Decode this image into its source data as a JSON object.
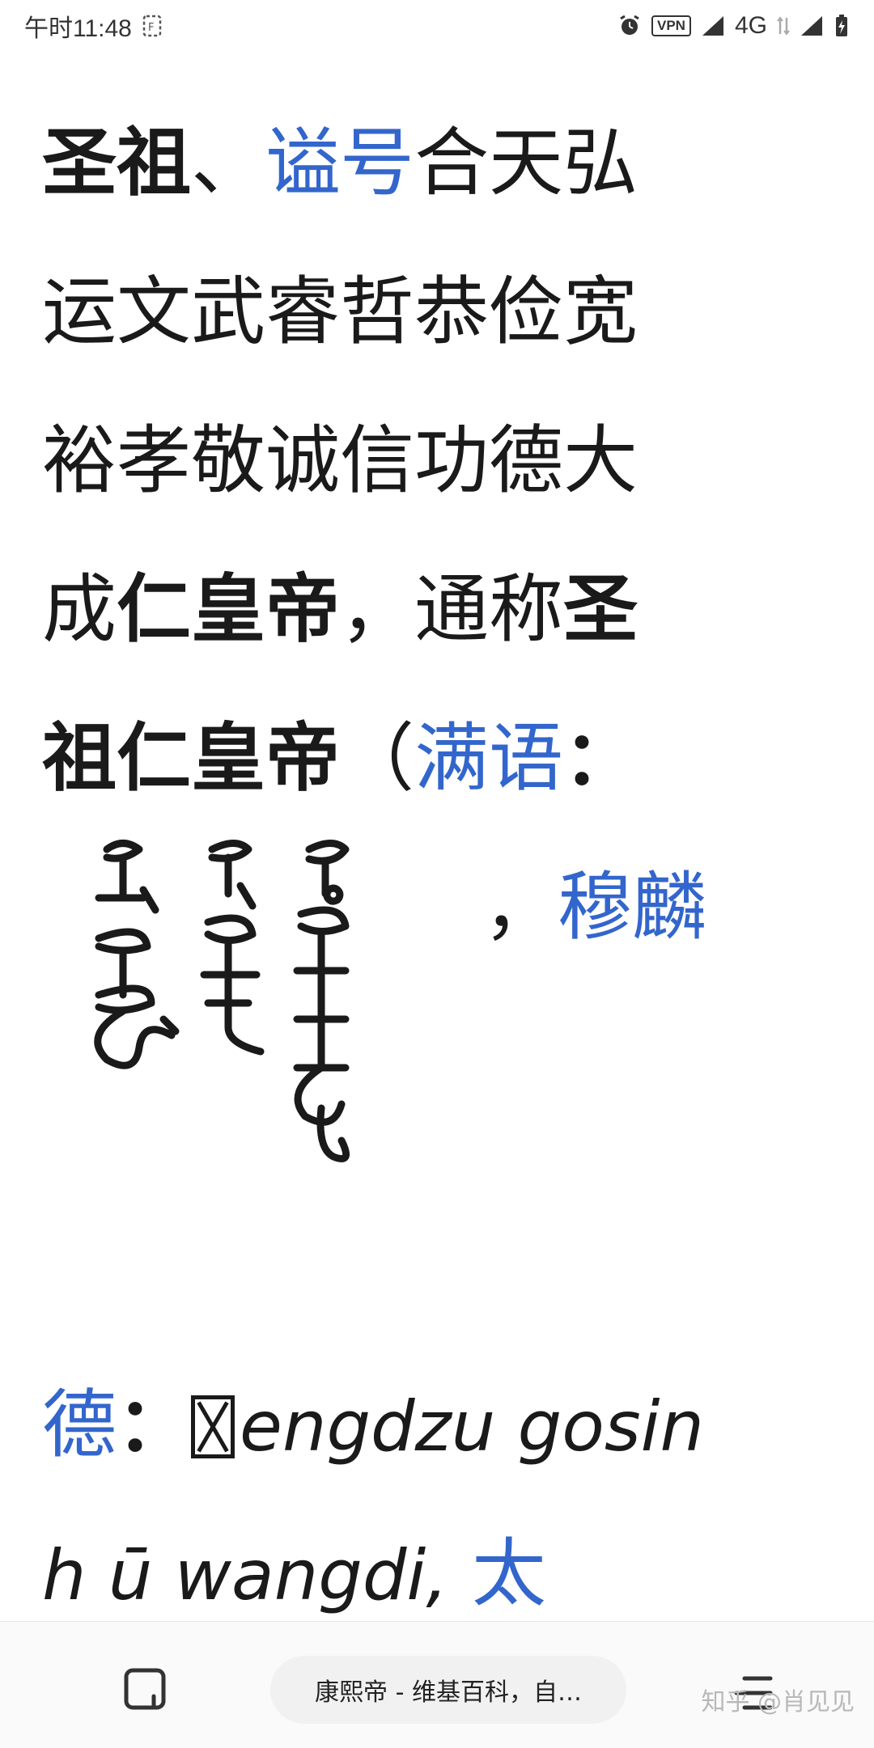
{
  "status_bar": {
    "time": "午时11:48",
    "vpn": "VPN",
    "network": "4G"
  },
  "article": {
    "line1": {
      "a": "圣祖",
      "sep": "、",
      "link": "谥号",
      "rest": "合天弘"
    },
    "line2": "运文武睿哲恭俭宽",
    "line3": "裕孝敬诚信功德大",
    "line4": {
      "a": "成",
      "b": "仁皇帝",
      "c": "，通称",
      "d": "圣"
    },
    "line5": {
      "a": "祖仁皇帝",
      "paren": "（",
      "link": "满语",
      "colon": "："
    },
    "line6": {
      "comma": "，",
      "link": "穆麟"
    },
    "line7": {
      "link": "德",
      "colon": "：",
      "latin": "engdzu gosin"
    },
    "line8": {
      "latin": "h ū wangdi",
      "comma": ",",
      "link": "太"
    }
  },
  "bottom_bar": {
    "url": "康熙帝 - 维基百科，自…"
  },
  "watermark": "知乎 @肖见见",
  "colors": {
    "link": "#3366cc",
    "text": "#1a1a1a"
  }
}
